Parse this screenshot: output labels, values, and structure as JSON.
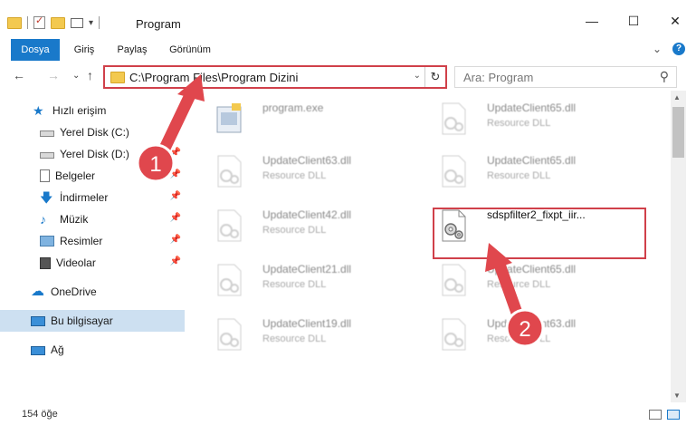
{
  "window": {
    "title": "Program",
    "controls": {
      "minimize": "—",
      "maximize": "☐",
      "close": "✕"
    }
  },
  "ribbon": {
    "tabs": [
      "Dosya",
      "Giriş",
      "Paylaş",
      "Görünüm"
    ],
    "help": "?",
    "collapse": "⌄"
  },
  "nav": {
    "back": "←",
    "forward": "→",
    "recent": "⌄",
    "up": "↑",
    "address": "C:\\Program Files\\Program Dizini",
    "dropdown": "⌄",
    "refresh": "↻",
    "search_placeholder": "Ara: Program",
    "search_icon": "⚲"
  },
  "sidebar": {
    "items": [
      {
        "label": "Hızlı erişim",
        "icon": "star-icon",
        "pinned": false
      },
      {
        "label": "Yerel Disk (C:)",
        "icon": "drive-icon",
        "pinned": true
      },
      {
        "label": "Yerel Disk (D:)",
        "icon": "drive-icon",
        "pinned": true
      },
      {
        "label": "Belgeler",
        "icon": "documents-icon",
        "pinned": true
      },
      {
        "label": "İndirmeler",
        "icon": "download-icon",
        "pinned": true
      },
      {
        "label": "Müzik",
        "icon": "music-icon",
        "pinned": true
      },
      {
        "label": "Resimler",
        "icon": "pictures-icon",
        "pinned": true
      },
      {
        "label": "Videolar",
        "icon": "video-icon",
        "pinned": true
      },
      {
        "label": "OneDrive",
        "icon": "cloud-icon",
        "pinned": false
      },
      {
        "label": "Bu bilgisayar",
        "icon": "computer-icon",
        "pinned": false,
        "selected": true
      },
      {
        "label": "Ağ",
        "icon": "network-icon",
        "pinned": false
      }
    ],
    "pin_glyph": "📌"
  },
  "files": [
    {
      "name": "program.exe",
      "type": "",
      "kind": "exe"
    },
    {
      "name": "UpdateClient65.dll",
      "type": "Resource DLL",
      "kind": "dll"
    },
    {
      "name": "UpdateClient63.dll",
      "type": "Resource DLL",
      "kind": "dll"
    },
    {
      "name": "UpdateClient65.dll",
      "type": "Resource DLL",
      "kind": "dll"
    },
    {
      "name": "UpdateClient42.dll",
      "type": "Resource DLL",
      "kind": "dll"
    },
    {
      "name": "sdspfilter2_fixpt_iir...",
      "type": "",
      "kind": "dll-gear",
      "highlighted": true
    },
    {
      "name": "UpdateClient21.dll",
      "type": "Resource DLL",
      "kind": "dll"
    },
    {
      "name": "UpdateClient65.dll",
      "type": "Resource DLL",
      "kind": "dll"
    },
    {
      "name": "UpdateClient19.dll",
      "type": "Resource DLL",
      "kind": "dll"
    },
    {
      "name": "UpdateClient63.dll",
      "type": "Resource DLL",
      "kind": "dll"
    }
  ],
  "status": {
    "item_count": "154 öğe"
  },
  "annotations": {
    "step1": "1",
    "step2": "2"
  },
  "colors": {
    "accent": "#1979ca",
    "annotation_red": "#d0404a",
    "folder": "#f3c94f"
  }
}
